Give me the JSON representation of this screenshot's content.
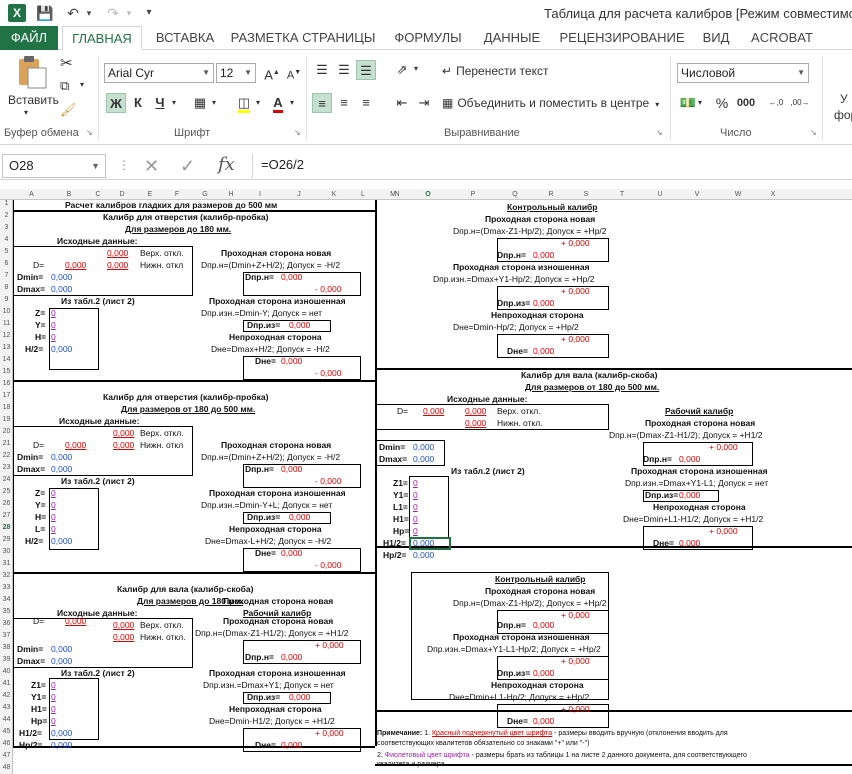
{
  "window": {
    "title": "Таблица для расчета калибров  [Режим совместимости",
    "app_icon": "X"
  },
  "tabs": [
    "ФАЙЛ",
    "ГЛАВНАЯ",
    "ВСТАВКА",
    "РАЗМЕТКА СТРАНИЦЫ",
    "ФОРМУЛЫ",
    "ДАННЫЕ",
    "РЕЦЕНЗИРОВАНИЕ",
    "ВИД",
    "ACROBAT"
  ],
  "ribbon": {
    "paste_label": "Вставить",
    "clipboard_label": "Буфер обмена",
    "font_label": "Шрифт",
    "alignment_label": "Выравнивание",
    "number_label": "Число",
    "font_name": "Arial Cyr",
    "font_size": "12",
    "bold": "Ж",
    "italic": "К",
    "underline": "Ч",
    "wrap_text": "Перенести текст",
    "merge_center": "Объединить и поместить в центре",
    "number_format": "Числовой",
    "cut_off_right": "фор",
    "cut_off_right_top": "У"
  },
  "formula_bar": {
    "name_box": "O28",
    "fx": "fx",
    "formula": "=O26/2"
  },
  "columns": [
    "A",
    "B",
    "C",
    "D",
    "E",
    "F",
    "G",
    "H",
    "I",
    "J",
    "K",
    "L",
    "M",
    "N",
    "O",
    "P",
    "Q",
    "R",
    "S",
    "T",
    "U",
    "V",
    "W",
    "X"
  ],
  "rows": [
    "1",
    "2",
    "3",
    "4",
    "5",
    "6",
    "7",
    "8",
    "9",
    "10",
    "11",
    "12",
    "13",
    "14",
    "15",
    "16",
    "17",
    "18",
    "19",
    "20",
    "21",
    "22",
    "23",
    "24",
    "25",
    "26",
    "27",
    "28",
    "29",
    "30",
    "31",
    "32",
    "33",
    "34",
    "35",
    "36",
    "37",
    "38",
    "39",
    "40",
    "41",
    "42",
    "43",
    "44",
    "45",
    "46",
    "47",
    "48"
  ],
  "sheet": {
    "main_title": "Расчет калибров гладких для размеров до 500 мм",
    "s1_title": "Калибр для отверстия (калибр-пробка)",
    "s1_sub": "Для размеров до 180 мм.",
    "input_data": "Исходные данные:",
    "zero": "0,000",
    "plus_zero": "+ 0,000",
    "minus_zero": "- 0,000",
    "upper_dev": "Верх. откл.",
    "lower_dev": "Нижн. откл",
    "lower_dev2": "Нижн. откл.",
    "d_eq": "D=",
    "dmin_eq": "Dmin=",
    "dmax_eq": "Dmax=",
    "from_table": "Из табл.2 (лист 2)",
    "z_eq": "Z=",
    "y_eq": "Y=",
    "h_eq": "H=",
    "l_eq": "L=",
    "h2_eq": "H/2=",
    "z1_eq": "Z1=",
    "y1_eq": "Y1=",
    "l1_eq": "L1=",
    "h1_eq": "H1=",
    "hp_eq": "Hp=",
    "h12_eq": "H1/2=",
    "hp2_eq": "Hp/2=",
    "zero_int": "0",
    "go_new": "Проходная сторона новая",
    "go_worn": "Проходная сторона изношенная",
    "nogo": "Непроходная сторона",
    "f_hole_go": "Dпр.н=(Dmin+Z+H/2);   Допуск = -H/2",
    "f_hole_worn": "Dпр.изн.=Dmin-Y;   Допуск = нет",
    "f_hole_worn2": "Dпр.изн.=Dmin-Y+L;   Допуск = нет",
    "f_hole_nogo": "Dне=Dmax+H/2;   Допуск = -H/2",
    "f_hole_nogo2": "Dне=Dmax-L+H/2;   Допуск = -H/2",
    "dprn": "Dпр.н=",
    "dpriz": "Dпр.из=",
    "dne": "Dне=",
    "s2_title": "Калибр для отверстия (калибр-пробка)",
    "s2_sub": "Для размеров от 180 до 500 мм.",
    "s3_title": "Калибр для вала (калибр-скоба)",
    "s3_sub": "Для размеров до 180 мм.",
    "work_gauge": "Рабочий калибр",
    "f_shaft_go": "Dпр.н=(Dmax-Z1-H1/2);   Допуск = +H1/2",
    "f_shaft_worn": "Dпр.изн.=Dmax+Y1;   Допуск = нет",
    "f_shaft_worn2": "Dпр.изн.=Dmax+Y1-L1;   Допуск = нет",
    "f_shaft_nogo": "Dне=Dmin-H1/2;   Допуск = +H1/2",
    "f_shaft_nogo2": "Dне=Dmin+L1-H1/2;   Допуск = +H1/2",
    "control_gauge": "Контрольный калибр",
    "f_ctrl_go": "Dпр.н=(Dmax-Z1-Hp/2);   Допуск = +Hp/2",
    "f_ctrl_worn": "Dпр.изн.=Dmax+Y1-Hp/2;   Допуск = +Hp/2",
    "f_ctrl_worn2": "Dпр.изн.=Dmax+Y1-L1-Hp/2;   Допуск = +Hp/2",
    "f_ctrl_nogo": "Dне=Dmin-Hp/2;   Допуск = +Hp/2",
    "f_ctrl_nogo2": "Dне=Dmin+L1-Hp/2;   Допуск = +Hp/2",
    "s4_title": "Калибр для вала (калибр-скоба)",
    "s4_sub": "Для размеров от 180 до 500 мм.",
    "upper_dev2": "Верх. откл.",
    "note_label": "Примечание:",
    "note_1": "1.",
    "note_red": "Красный подчеркнутый цвет шрифта",
    "note_1_rest": " - размеры вводить вручную (отклонения вводить для",
    "note_1_line2": "соответствующих квалитетов обязательно со знаками \"+\" или \"-\")",
    "note_2": "2.",
    "note_purple": "Фиолетовый цвет шрифта",
    "note_2_rest": " - размеры брать из таблицы 1 на листе 2 данного документа, для соответствующего",
    "note_2_line2": "квалитета и размера."
  }
}
